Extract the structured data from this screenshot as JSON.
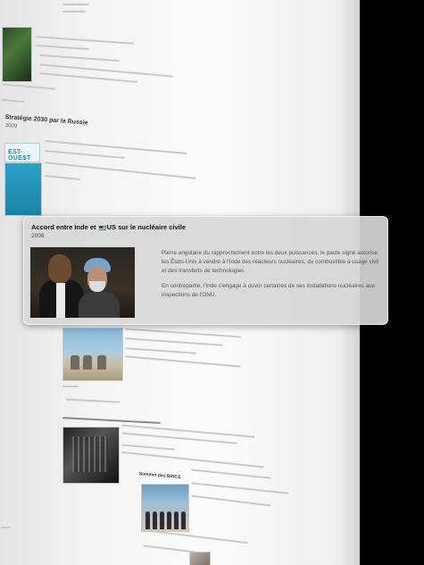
{
  "card": {
    "title_before": "Accord entre Inde et",
    "title_after": "US  sur le nucléaire civile",
    "year": "2008",
    "paragraph_1": "Pierre angulaire du rapprochement entre les deux puissances, le pacte signé autorise les États-Unis à vendre à l'Inde des réacteurs nucléaires, du combustible à usage civil et des transferts de technologies.",
    "paragraph_2": "En contrepartie, l'Inde s'engage à ouvrir certaines de ses installations nucléaires aux inspections de l'ONU."
  },
  "background": {
    "section_russia": {
      "title": "Stratégie 2030 par la Russie",
      "year": "2009"
    },
    "est_ouest_logo": "EST-OUEST",
    "section_brics": {
      "title": "Sommet des BRICS"
    }
  }
}
